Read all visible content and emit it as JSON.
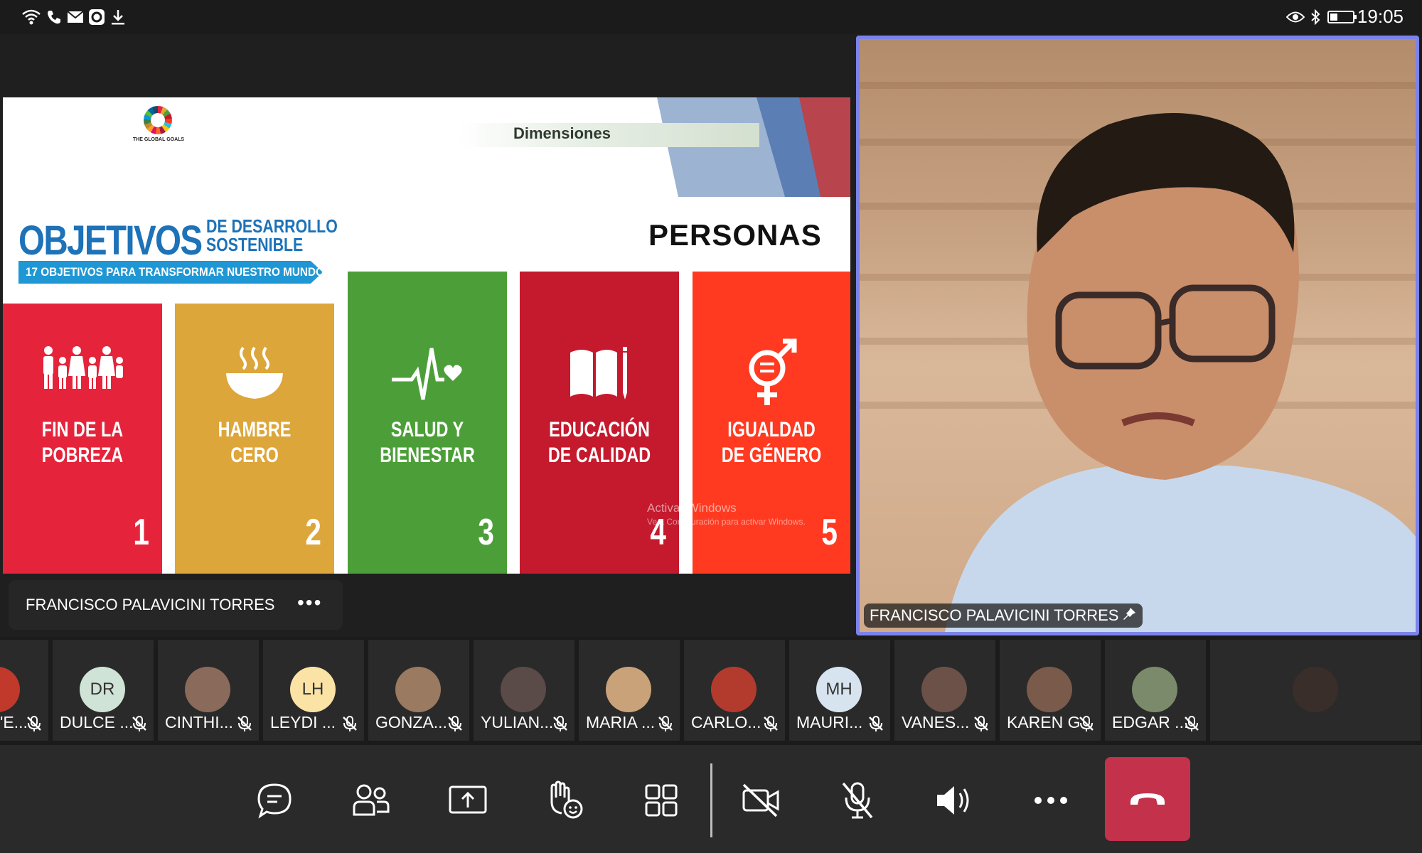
{
  "status_bar": {
    "time": "19:05",
    "icons_left": [
      "wifi-icon",
      "phone-icon",
      "mail-icon",
      "app-icon",
      "download-icon"
    ],
    "icons_right": [
      "eye-icon",
      "bluetooth-icon",
      "battery-icon"
    ]
  },
  "slide": {
    "logo_text": "THE GLOBAL GOALS",
    "section_label": "Dimensiones",
    "title_main": "OBJETIVOS",
    "title_sub_line1": "DE DESARROLLO",
    "title_sub_line2": "SOSTENIBLE",
    "banner": "17 OBJETIVOS PARA TRANSFORMAR NUESTRO MUNDO",
    "heading": "PERSONAS",
    "cards": [
      {
        "line1": "FIN DE LA",
        "line2": "POBREZA",
        "number": "1",
        "color": "#e5243b",
        "icon": "family-icon"
      },
      {
        "line1": "HAMBRE",
        "line2": "CERO",
        "number": "2",
        "color": "#dda63a",
        "icon": "bowl-icon"
      },
      {
        "line1": "SALUD Y",
        "line2": "BIENESTAR",
        "number": "3",
        "color": "#4c9f38",
        "icon": "heartbeat-icon"
      },
      {
        "line1": "EDUCACIÓN",
        "line2": "DE CALIDAD",
        "number": "4",
        "color": "#c5192d",
        "icon": "book-icon"
      },
      {
        "line1": "IGUALDAD",
        "line2": "DE GÉNERO",
        "number": "5",
        "color": "#ff3a21",
        "icon": "gender-icon"
      }
    ],
    "watermark_line1": "Activar Windows",
    "watermark_line2": "Ve a Configuración para activar Windows."
  },
  "presenter": {
    "name": "FRANCISCO PALAVICINI TORRES",
    "more": "•••"
  },
  "video": {
    "name": "FRANCISCO PALAVICINI TORRES"
  },
  "participants": [
    {
      "initials": "",
      "name": "'E...",
      "avatar_color": "#c0392b",
      "photo": true
    },
    {
      "initials": "DR",
      "name": "DULCE ...",
      "avatar_color": "#cfe3d6",
      "photo": false
    },
    {
      "initials": "",
      "name": "CINTHI...",
      "avatar_color": "#8a6a5a",
      "photo": true
    },
    {
      "initials": "LH",
      "name": "LEYDI ...",
      "avatar_color": "#fbe3a6",
      "photo": false
    },
    {
      "initials": "",
      "name": "GONZA...",
      "avatar_color": "#9a7a60",
      "photo": true
    },
    {
      "initials": "",
      "name": "YULIAN...",
      "avatar_color": "#5a4a48",
      "photo": true
    },
    {
      "initials": "",
      "name": "MARIA ...",
      "avatar_color": "#c9a27a",
      "photo": true
    },
    {
      "initials": "",
      "name": "CARLO...",
      "avatar_color": "#b33b2e",
      "photo": true
    },
    {
      "initials": "MH",
      "name": "MAURI...",
      "avatar_color": "#d7e4ef",
      "photo": false
    },
    {
      "initials": "",
      "name": "VANES...",
      "avatar_color": "#6b5148",
      "photo": true
    },
    {
      "initials": "",
      "name": "KAREN G",
      "avatar_color": "#7a5a4a",
      "photo": true
    },
    {
      "initials": "",
      "name": "EDGAR ...",
      "avatar_color": "#7a8a6a",
      "photo": true
    },
    {
      "initials": "",
      "name": "",
      "avatar_color": "#3a2e2a",
      "photo": true
    }
  ],
  "toolbar": {
    "buttons": [
      "chat-icon",
      "people-icon",
      "share-screen-icon",
      "raise-hand-icon",
      "layout-icon",
      "camera-off-icon",
      "mic-off-icon",
      "speaker-icon",
      "more-icon",
      "hang-up-icon"
    ],
    "accent_color": "#7b83eb",
    "hangup_color": "#c4314b"
  }
}
